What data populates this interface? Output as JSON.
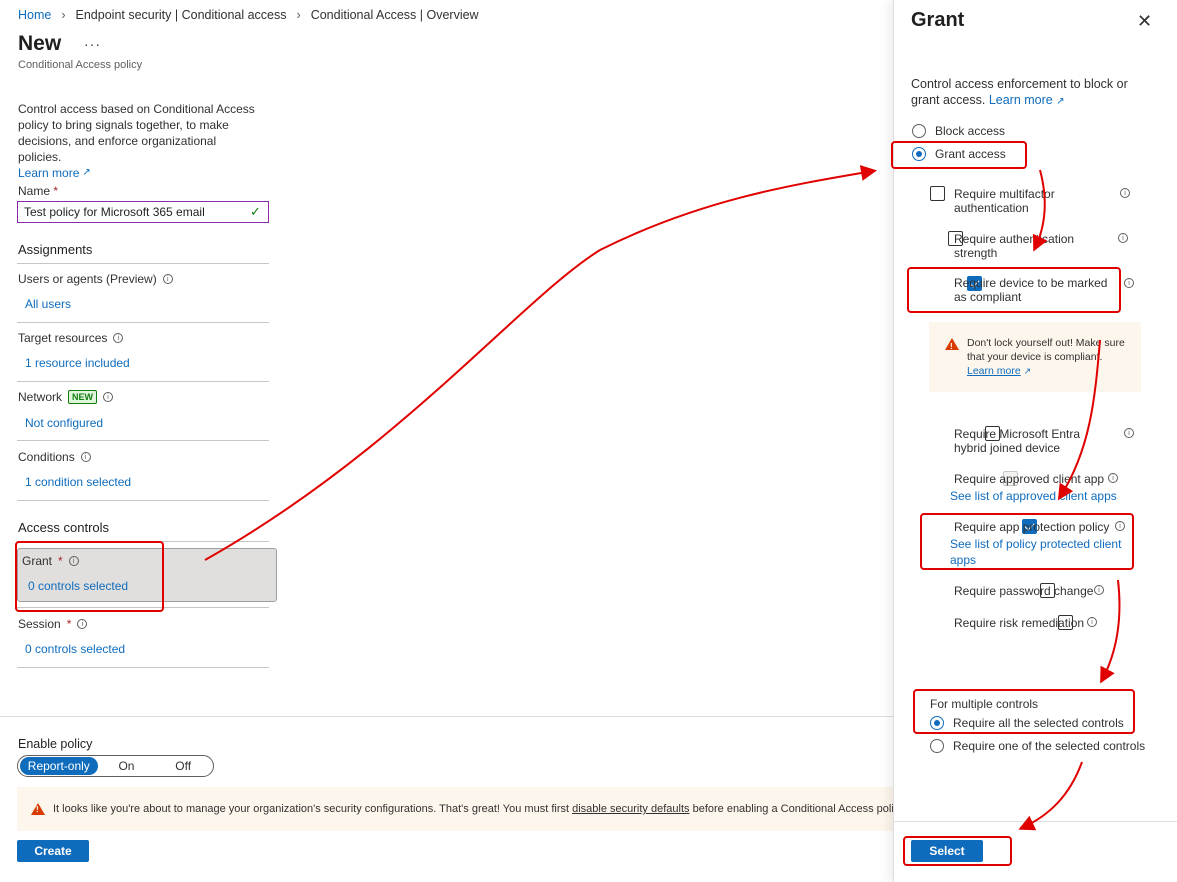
{
  "breadcrumb": [
    "Home",
    "Endpoint security | Conditional access",
    "Conditional Access | Overview"
  ],
  "page": {
    "title": "New",
    "subtitle": "Conditional Access policy",
    "description": "Control access based on Conditional Access policy to bring signals together, to make decisions, and enforce organizational policies.",
    "learn_more": "Learn more"
  },
  "name_field": {
    "label": "Name",
    "required_mark": "*",
    "value": "Test policy for Microsoft 365 email"
  },
  "assignments": {
    "title": "Assignments",
    "users_label": "Users or agents (Preview)",
    "users_value": "All users",
    "targets_label": "Target resources",
    "targets_value": "1 resource included",
    "network_label": "Network",
    "network_badge": "NEW",
    "network_value": "Not configured",
    "conditions_label": "Conditions",
    "conditions_value": "1 condition selected"
  },
  "access_controls": {
    "title": "Access controls",
    "grant_label": "Grant",
    "grant_value": "0 controls selected",
    "session_label": "Session",
    "session_value": "0 controls selected"
  },
  "enable_policy": {
    "label": "Enable policy",
    "options": [
      "Report-only",
      "On",
      "Off"
    ],
    "selected": "Report-only"
  },
  "warning": {
    "text_before": "It looks like you're about to manage your organization's security configurations. That's great! You must first",
    "link": "disable security defaults",
    "text_after": "before enabling a Conditional Access policy."
  },
  "create_button": "Create",
  "grant_panel": {
    "title": "Grant",
    "description": "Control access enforcement to block or grant access.",
    "learn_more": "Learn more",
    "block_access": "Block access",
    "grant_access": "Grant access",
    "selected_mode": "Grant access",
    "controls": [
      {
        "label": "Require multifactor authentication",
        "checked": false
      },
      {
        "label": "Require authentication strength",
        "checked": false
      },
      {
        "label": "Require device to be marked as compliant",
        "checked": true
      },
      {
        "label": "Require Microsoft Entra hybrid joined device",
        "checked": false
      },
      {
        "label": "Require approved client app",
        "checked": false,
        "link": "See list of approved client apps"
      },
      {
        "label": "Require app protection policy",
        "checked": true,
        "link": "See list of policy protected client apps"
      },
      {
        "label": "Require password change",
        "checked": false
      },
      {
        "label": "Require risk remediation",
        "checked": false
      }
    ],
    "lockout_warning": "Don't lock yourself out! Make sure that your device is compliant.",
    "lockout_learn_more": "Learn more",
    "multiple_controls_label": "For multiple controls",
    "require_all": "Require all the selected controls",
    "require_one": "Require one of the selected controls",
    "multiple_selected": "Require all the selected controls",
    "select_button": "Select"
  },
  "colors": {
    "accent": "#0f6cbd",
    "annotation": "#e00000",
    "warning_bg": "#fdf6ec",
    "warning_icon": "#d83b01"
  }
}
